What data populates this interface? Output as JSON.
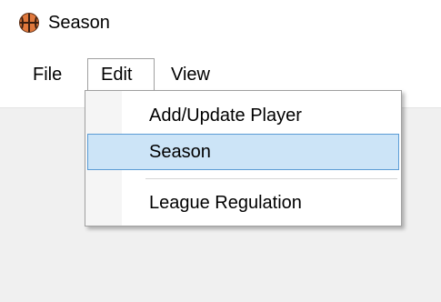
{
  "window": {
    "title": "Season",
    "icon": "basketball-icon"
  },
  "menubar": {
    "items": [
      {
        "label": "File"
      },
      {
        "label": "Edit",
        "open": true
      },
      {
        "label": "View"
      }
    ]
  },
  "edit_menu": {
    "items": [
      {
        "label": "Add/Update Player",
        "highlighted": false
      },
      {
        "label": "Season",
        "highlighted": true
      },
      {
        "label": "League Regulation",
        "highlighted": false
      }
    ]
  },
  "colors": {
    "highlight_fill": "#cce4f7",
    "highlight_border": "#5a9bd5",
    "icon_orange": "#e0783c"
  }
}
